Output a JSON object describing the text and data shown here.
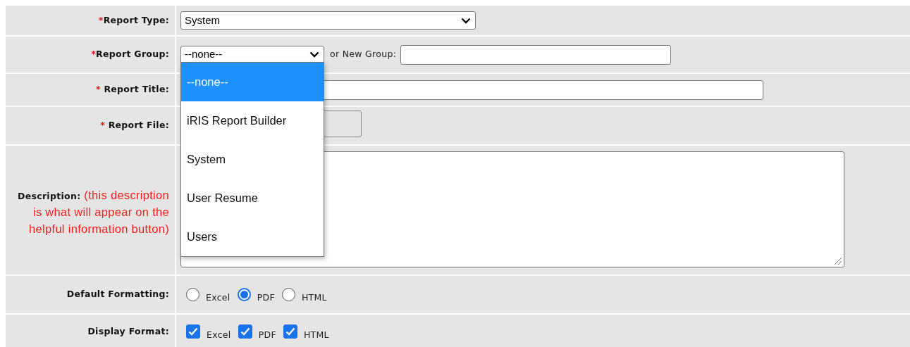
{
  "fields": [
    {
      "kind": "select",
      "marker": "*",
      "label": "Report Type:",
      "value": "System"
    },
    {
      "kind": "group",
      "marker": "*",
      "label": "Report Group:",
      "value": "--none--",
      "expanded": true,
      "new_label": "or New Group:",
      "options": [
        {
          "label": "--none--",
          "selected": true
        },
        {
          "label": "iRIS Report Builder",
          "selected": false
        },
        {
          "label": "System",
          "selected": false
        },
        {
          "label": "User Resume",
          "selected": false
        },
        {
          "label": "Users",
          "selected": false
        }
      ]
    },
    {
      "kind": "text",
      "marker": "*",
      "label": "Report Title:"
    },
    {
      "kind": "file",
      "marker": "*",
      "label": "Report File:"
    },
    {
      "kind": "textarea",
      "label": "Description:",
      "note": "(this description is what will appear on the helpful information button)"
    },
    {
      "kind": "radio",
      "label": "Default Formatting:",
      "options": [
        {
          "label": "Excel",
          "selected": false
        },
        {
          "label": "PDF",
          "selected": true
        },
        {
          "label": "HTML",
          "selected": false
        }
      ]
    },
    {
      "kind": "checkbox",
      "label": "Display Format:",
      "options": [
        {
          "label": "Excel",
          "checked": true
        },
        {
          "label": "PDF",
          "checked": true
        },
        {
          "label": "HTML",
          "checked": true
        }
      ]
    }
  ]
}
